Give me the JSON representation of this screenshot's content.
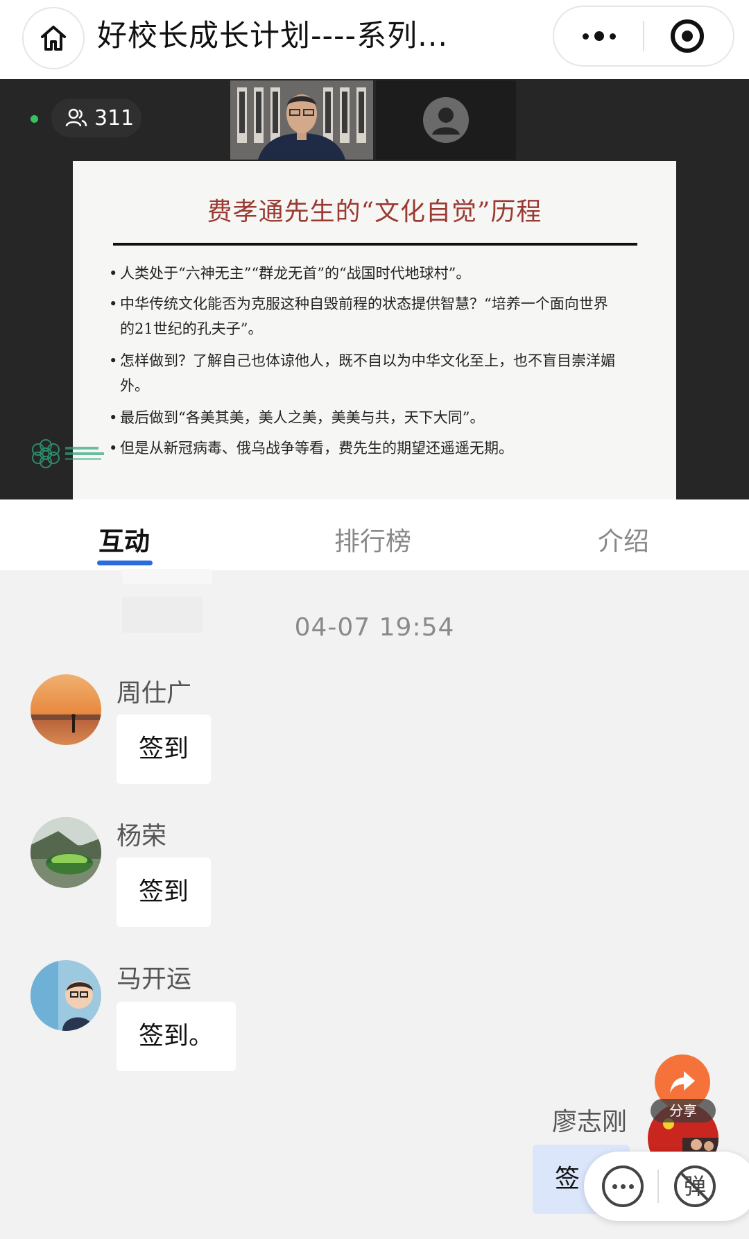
{
  "nav": {
    "title": "好校长成长计划----系列..."
  },
  "live": {
    "viewers": "311"
  },
  "slide": {
    "title": "费孝通先生的“文化自觉”历程",
    "bullets": [
      "人类处于“六神无主”“群龙无首”的“战国时代地球村”。",
      "中华传统文化能否为克服这种自毁前程的状态提供智慧？“培养一个面向世界的21世纪的孔夫子”。",
      "怎样做到？了解自己也体谅他人，既不自以为中华文化至上，也不盲目崇洋媚外。",
      "最后做到“各美其美，美人之美，美美与共，天下大同”。",
      "但是从新冠病毒、俄乌战争等看，费先生的期望还遥遥无期。"
    ]
  },
  "tabs": [
    {
      "label": "互动"
    },
    {
      "label": "排行榜"
    },
    {
      "label": "介绍"
    }
  ],
  "chat": {
    "timestamp": "04-07 19:54",
    "messages": [
      {
        "name": "周仕广",
        "text": "签到"
      },
      {
        "name": "杨荣",
        "text": "签到"
      },
      {
        "name": "马开运",
        "text": "签到。"
      },
      {
        "name": "廖志刚",
        "text": "签"
      }
    ]
  },
  "floating": {
    "share_label": "分享",
    "danmu_label": "弹"
  },
  "colors": {
    "tab_accent": "#2b6be0",
    "share_orange": "#f5733a",
    "slide_title": "#9a3a32",
    "live_dot": "#37c25e"
  }
}
